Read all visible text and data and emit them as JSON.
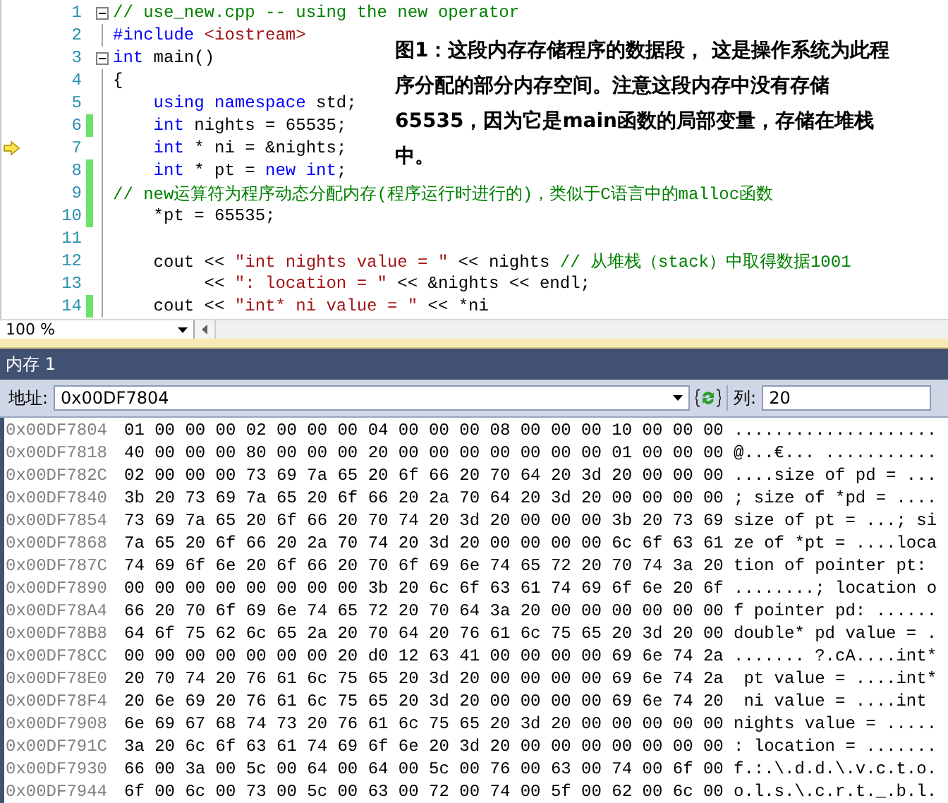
{
  "editor": {
    "lines": [
      {
        "number": "1",
        "fold": true,
        "changed": false,
        "current": false,
        "segments": [
          {
            "kind": "comment",
            "text": "// use_new.cpp -- using the new operator"
          }
        ]
      },
      {
        "number": "2",
        "fold": false,
        "changed": false,
        "current": false,
        "segments": [
          {
            "kind": "preprocessor",
            "text": "#include"
          },
          {
            "kind": "string",
            "text": " <iostream>"
          }
        ]
      },
      {
        "number": "3",
        "fold": true,
        "changed": false,
        "current": false,
        "segments": [
          {
            "kind": "keyword",
            "text": "int"
          },
          {
            "kind": "plain",
            "text": " main()"
          }
        ]
      },
      {
        "number": "4",
        "fold": false,
        "changed": false,
        "current": false,
        "segments": [
          {
            "kind": "plain",
            "text": "{"
          }
        ]
      },
      {
        "number": "5",
        "fold": false,
        "changed": false,
        "current": false,
        "segments": [
          {
            "kind": "keyword",
            "text": "    using"
          },
          {
            "kind": "keyword",
            "text": " namespace"
          },
          {
            "kind": "plain",
            "text": " std;"
          }
        ]
      },
      {
        "number": "6",
        "fold": false,
        "changed": true,
        "current": false,
        "segments": [
          {
            "kind": "keyword",
            "text": "    int"
          },
          {
            "kind": "plain",
            "text": " nights = 65535;"
          }
        ]
      },
      {
        "number": "7",
        "fold": false,
        "changed": false,
        "current": true,
        "segments": [
          {
            "kind": "keyword",
            "text": "    int"
          },
          {
            "kind": "plain",
            "text": " * ni = &nights;"
          }
        ]
      },
      {
        "number": "8",
        "fold": false,
        "changed": true,
        "current": false,
        "segments": [
          {
            "kind": "keyword",
            "text": "    int"
          },
          {
            "kind": "plain",
            "text": " * pt = "
          },
          {
            "kind": "keyword",
            "text": "new"
          },
          {
            "kind": "keyword",
            "text": " int"
          },
          {
            "kind": "plain",
            "text": ";"
          }
        ]
      },
      {
        "number": "9",
        "fold": false,
        "changed": true,
        "current": false,
        "segments": [
          {
            "kind": "comment",
            "text": "// new运算符为程序动态分配内存(程序运行时进行的)，类似于C语言中的malloc函数"
          }
        ]
      },
      {
        "number": "10",
        "fold": false,
        "changed": true,
        "current": false,
        "segments": [
          {
            "kind": "plain",
            "text": "    *pt = 65535;"
          }
        ]
      },
      {
        "number": "11",
        "fold": false,
        "changed": false,
        "current": false
      },
      {
        "number": "12",
        "fold": false,
        "changed": false,
        "current": false,
        "segments": [
          {
            "kind": "plain",
            "text": "    cout << "
          },
          {
            "kind": "string",
            "text": "\"int nights value = \""
          },
          {
            "kind": "plain",
            "text": " << nights "
          },
          {
            "kind": "comment",
            "text": "// 从堆栈（stack）中取得数据1001"
          }
        ]
      },
      {
        "number": "13",
        "fold": false,
        "changed": false,
        "current": false,
        "segments": [
          {
            "kind": "plain",
            "text": "         << "
          },
          {
            "kind": "string",
            "text": "\": location = \""
          },
          {
            "kind": "plain",
            "text": " << &nights << endl;"
          }
        ]
      },
      {
        "number": "14",
        "fold": false,
        "changed": true,
        "current": false,
        "segments": [
          {
            "kind": "plain",
            "text": "    cout << "
          },
          {
            "kind": "string",
            "text": "\"int* ni value = \""
          },
          {
            "kind": "plain",
            "text": " << *ni"
          }
        ]
      }
    ],
    "zoom": "100 %"
  },
  "annotation": "图1：这段内存存储程序的数据段， 这是操作系统为此程序分配的部分内存空间。注意这段内存中没有存储65535，因为它是main函数的局部变量，存储在堆栈中。",
  "memory_panel": {
    "title": "内存 1",
    "address_label": "地址:",
    "address_value": "0x00DF7804",
    "columns_label": "列:",
    "columns_value": "20",
    "rows": [
      {
        "address": "0x00DF7804",
        "bytes": "01 00 00 00 02 00 00 00 04 00 00 00 08 00 00 00 10 00 00 00",
        "ascii": "...................."
      },
      {
        "address": "0x00DF7818",
        "bytes": "40 00 00 00 80 00 00 00 20 00 00 00 00 00 00 00 01 00 00 00",
        "ascii": "@...€... ..........."
      },
      {
        "address": "0x00DF782C",
        "bytes": "02 00 00 00 73 69 7a 65 20 6f 66 20 70 64 20 3d 20 00 00 00",
        "ascii": "....size of pd = ..."
      },
      {
        "address": "0x00DF7840",
        "bytes": "3b 20 73 69 7a 65 20 6f 66 20 2a 70 64 20 3d 20 00 00 00 00",
        "ascii": "; size of *pd = ...."
      },
      {
        "address": "0x00DF7854",
        "bytes": "73 69 7a 65 20 6f 66 20 70 74 20 3d 20 00 00 00 3b 20 73 69",
        "ascii": "size of pt = ...; si"
      },
      {
        "address": "0x00DF7868",
        "bytes": "7a 65 20 6f 66 20 2a 70 74 20 3d 20 00 00 00 00 6c 6f 63 61",
        "ascii": "ze of *pt = ....loca"
      },
      {
        "address": "0x00DF787C",
        "bytes": "74 69 6f 6e 20 6f 66 20 70 6f 69 6e 74 65 72 20 70 74 3a 20",
        "ascii": "tion of pointer pt:"
      },
      {
        "address": "0x00DF7890",
        "bytes": "00 00 00 00 00 00 00 00 3b 20 6c 6f 63 61 74 69 6f 6e 20 6f",
        "ascii": "........; location o"
      },
      {
        "address": "0x00DF78A4",
        "bytes": "66 20 70 6f 69 6e 74 65 72 20 70 64 3a 20 00 00 00 00 00 00",
        "ascii": "f pointer pd: ......"
      },
      {
        "address": "0x00DF78B8",
        "bytes": "64 6f 75 62 6c 65 2a 20 70 64 20 76 61 6c 75 65 20 3d 20 00",
        "ascii": "double* pd value = ."
      },
      {
        "address": "0x00DF78CC",
        "bytes": "00 00 00 00 00 00 00 20 d0 12 63 41 00 00 00 00 69 6e 74 2a",
        "ascii": "....... ?.cA....int*"
      },
      {
        "address": "0x00DF78E0",
        "bytes": "20 70 74 20 76 61 6c 75 65 20 3d 20 00 00 00 00 69 6e 74 2a",
        "ascii": " pt value = ....int*"
      },
      {
        "address": "0x00DF78F4",
        "bytes": "20 6e 69 20 76 61 6c 75 65 20 3d 20 00 00 00 00 69 6e 74 20",
        "ascii": " ni value = ....int"
      },
      {
        "address": "0x00DF7908",
        "bytes": "6e 69 67 68 74 73 20 76 61 6c 75 65 20 3d 20 00 00 00 00 00",
        "ascii": "nights value = ....."
      },
      {
        "address": "0x00DF791C",
        "bytes": "3a 20 6c 6f 63 61 74 69 6f 6e 20 3d 20 00 00 00 00 00 00 00",
        "ascii": ": location = ......."
      },
      {
        "address": "0x00DF7930",
        "bytes": "66 00 3a 00 5c 00 64 00 64 00 5c 00 76 00 63 00 74 00 6f 00",
        "ascii": "f.:.\\.d.d.\\.v.c.t.o."
      },
      {
        "address": "0x00DF7944",
        "bytes": "6f 00 6c 00 73 00 5c 00 63 00 72 00 74 00 5f 00 62 00 6c 00",
        "ascii": "o.l.s.\\.c.r.t._.b.l."
      }
    ]
  }
}
